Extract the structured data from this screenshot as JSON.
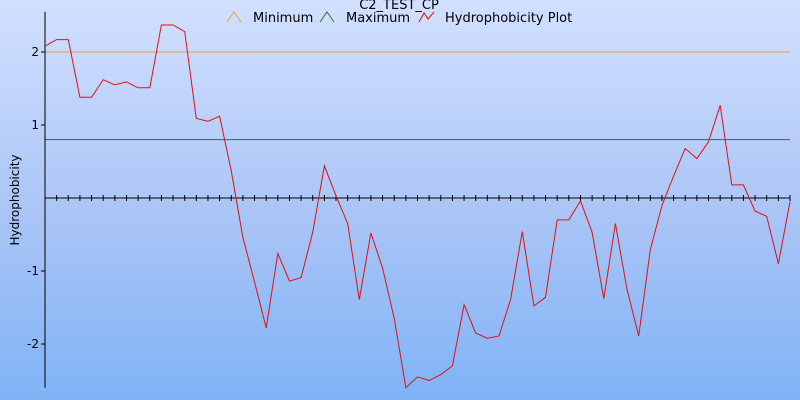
{
  "chart_data": {
    "type": "line",
    "title": "C2_TEST_CP",
    "xlabel": "",
    "ylabel": "Hydrophobicity",
    "ylim": [
      -2.6,
      2.55
    ],
    "xlim": [
      0,
      64
    ],
    "yticks": [
      {
        "value": 2,
        "label": "2"
      },
      {
        "value": 1,
        "label": "1"
      },
      {
        "value": -1,
        "label": "-1"
      },
      {
        "value": -2,
        "label": "-2"
      }
    ],
    "x_axis_at": 0,
    "grid": false,
    "legend_position": "top",
    "series": [
      {
        "name": "Minimum",
        "color": "#e8a040",
        "marker": "caret",
        "values": [
          2.0,
          2.0
        ]
      },
      {
        "name": "Maximum",
        "color": "#1f7a1f",
        "marker": "caret",
        "values": [
          0.8,
          0.8
        ]
      },
      {
        "name": "Hydrophobicity Plot",
        "color": "#e01010",
        "marker": "caret",
        "values": [
          2.08,
          2.17,
          2.17,
          1.38,
          1.38,
          1.62,
          1.55,
          1.59,
          1.51,
          1.51,
          2.37,
          2.37,
          2.28,
          1.09,
          1.05,
          1.12,
          0.37,
          -0.54,
          -1.15,
          -1.78,
          -0.76,
          -1.14,
          -1.09,
          -0.47,
          0.44,
          0.03,
          -0.35,
          -1.39,
          -0.48,
          -0.96,
          -1.65,
          -2.6,
          -2.45,
          -2.5,
          -2.42,
          -2.3,
          -1.46,
          -1.85,
          -1.92,
          -1.89,
          -1.39,
          -0.46,
          -1.48,
          -1.36,
          -0.3,
          -0.3,
          -0.04,
          -0.47,
          -1.38,
          -0.35,
          -1.25,
          -1.89,
          -0.71,
          -0.1,
          0.3,
          0.68,
          0.54,
          0.77,
          1.27,
          0.18,
          0.18,
          -0.18,
          -0.25,
          -0.9,
          -0.05
        ]
      }
    ]
  }
}
